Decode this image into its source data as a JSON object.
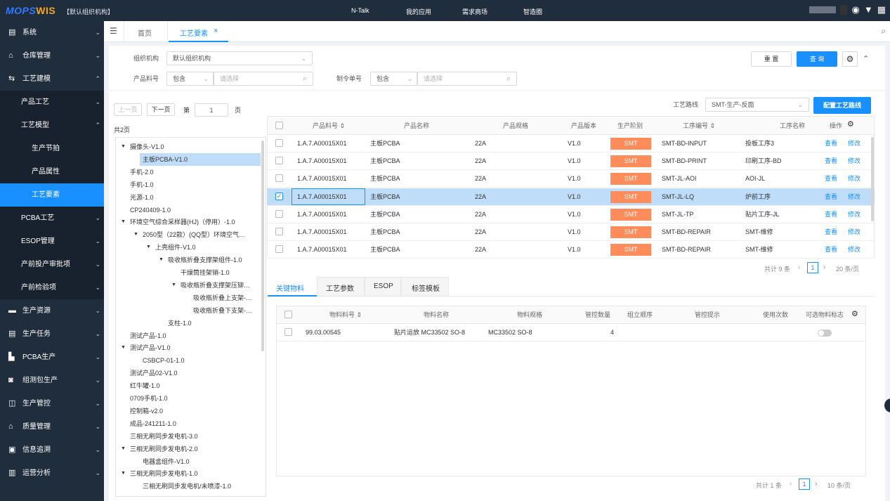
{
  "topbar": {
    "logo_a": "MOPS",
    "logo_b": "WIS",
    "org": "【默认组织机构】",
    "nav": [
      "N-Talk",
      "我的应用",
      "需求商场",
      "智造圈"
    ]
  },
  "sidebar": {
    "items": [
      {
        "icon": "▤",
        "label": "系统",
        "chev": "⌄"
      },
      {
        "icon": "⌂",
        "label": "仓库管理",
        "chev": "⌄"
      },
      {
        "icon": "⇆",
        "label": "工艺建模",
        "chev": "⌃"
      },
      {
        "label": "产品工艺",
        "chev": "⌄"
      },
      {
        "label": "工艺模型",
        "chev": "⌃"
      },
      {
        "label": "生产节拍"
      },
      {
        "label": "产品属性"
      },
      {
        "label": "工艺要素"
      },
      {
        "label": "PCBA工艺",
        "chev": "⌄"
      },
      {
        "label": "ESOP管理",
        "chev": "⌄"
      },
      {
        "label": "产前投产审批项",
        "chev": "⌄"
      },
      {
        "label": "产前检验项",
        "chev": "⌄"
      },
      {
        "icon": "▬",
        "label": "生产资源",
        "chev": "⌄"
      },
      {
        "icon": "▤",
        "label": "生产任务",
        "chev": "⌄"
      },
      {
        "icon": "▙",
        "label": "PCBA生产",
        "chev": "⌄"
      },
      {
        "icon": "◙",
        "label": "组测包生产",
        "chev": "⌄"
      },
      {
        "icon": "◫",
        "label": "生产管控",
        "chev": "⌄"
      },
      {
        "icon": "⌂",
        "label": "质量管理",
        "chev": "⌄"
      },
      {
        "icon": "▣",
        "label": "信息追溯",
        "chev": "⌄"
      },
      {
        "icon": "▥",
        "label": "运营分析",
        "chev": "⌄"
      }
    ]
  },
  "tabs": {
    "home": "首页",
    "active": "工艺要素",
    "close": "×"
  },
  "filters": {
    "org_label": "组织机构",
    "org_value": "默认组织机构",
    "pn_label": "产品料号",
    "pn_mode": "包含",
    "pn_placeholder": "请选择",
    "wo_label": "制令单号",
    "wo_mode": "包含",
    "wo_placeholder": "请选择",
    "reset": "重 置",
    "query": "查 询"
  },
  "pager": {
    "prev": "上一页",
    "next": "下一页",
    "di": "第",
    "page": "1",
    "ye": "页",
    "total": "共2页"
  },
  "tree": [
    {
      "t": "摄像头-V1.0",
      "d": 0,
      "o": "▼"
    },
    {
      "t": "主板PCBA-V1.0",
      "d": 1,
      "sel": true
    },
    {
      "t": "手机-2.0",
      "d": 0
    },
    {
      "t": "手机-1.0",
      "d": 0
    },
    {
      "t": "光源-1.0",
      "d": 0
    },
    {
      "t": "CP240409-1.0",
      "d": 0
    },
    {
      "t": "环境空气综合采样器(HJ)（停用）-1.0",
      "d": 0,
      "o": "▼"
    },
    {
      "t": "2050型（22款）(QQ型）环境空气…",
      "d": 1,
      "o": "▼"
    },
    {
      "t": "上壳组件-V1.0",
      "d": 2,
      "o": "▼"
    },
    {
      "t": "吸收瓶折叠支撑架组件-1.0",
      "d": 3,
      "o": "▼"
    },
    {
      "t": "干燥筒挂架销-1.0",
      "d": 4
    },
    {
      "t": "吸收瓶折叠支撑架压铆…",
      "d": 4,
      "o": "▼"
    },
    {
      "t": "吸收瓶折叠上支架-…",
      "d": 5
    },
    {
      "t": "吸收瓶折叠下支架-…",
      "d": 5
    },
    {
      "t": "支柱-1.0",
      "d": 3
    },
    {
      "t": "测试产品-1.0",
      "d": 0
    },
    {
      "t": "测试产品-V1.0",
      "d": 0,
      "o": "▼"
    },
    {
      "t": "CSBCP-01-1.0",
      "d": 1
    },
    {
      "t": "测试产品02-V1.0",
      "d": 0
    },
    {
      "t": "红牛罐-1.0",
      "d": 0
    },
    {
      "t": "0709手机-1.0",
      "d": 0
    },
    {
      "t": "控制箱-v2.0",
      "d": 0
    },
    {
      "t": "成品-241211-1.0",
      "d": 0
    },
    {
      "t": "三相无刷同步发电机-3.0",
      "d": 0
    },
    {
      "t": "三相无刷同步发电机-2.0",
      "d": 0,
      "o": "▼"
    },
    {
      "t": "电器盒组件-V1.0",
      "d": 1
    },
    {
      "t": "三相无刷同步发电机-1.0",
      "d": 0,
      "o": "▼"
    },
    {
      "t": "三相无刷同步发电机/未喷漆-1.0",
      "d": 1
    }
  ],
  "route": {
    "label": "工艺路线",
    "value": "SMT-生产-反面",
    "config": "配置工艺路线"
  },
  "grid": {
    "headers": [
      "产品料号 ⇕",
      "产品名称",
      "产品规格",
      "产品版本",
      "生产阶别",
      "工序编号 ⇕",
      "工序名称",
      "操作"
    ],
    "rows": [
      {
        "pn": "1.A.7.A00015X01",
        "name": "主板PCBA",
        "spec": "22A",
        "ver": "V1.0",
        "stage": "SMT",
        "code": "SMT-BD-INPUT",
        "proc": "投板工序3",
        "checked": false
      },
      {
        "pn": "1.A.7.A00015X01",
        "name": "主板PCBA",
        "spec": "22A",
        "ver": "V1.0",
        "stage": "SMT",
        "code": "SMT-BD-PRINT",
        "proc": "印刷工序-BD",
        "checked": false
      },
      {
        "pn": "1.A.7.A00015X01",
        "name": "主板PCBA",
        "spec": "22A",
        "ver": "V1.0",
        "stage": "SMT",
        "code": "SMT-JL-AOI",
        "proc": "AOI-JL",
        "checked": false
      },
      {
        "pn": "1.A.7.A00015X01",
        "name": "主板PCBA",
        "spec": "22A",
        "ver": "V1.0",
        "stage": "SMT",
        "code": "SMT-JL-LQ",
        "proc": "炉前工序",
        "checked": true
      },
      {
        "pn": "1.A.7.A00015X01",
        "name": "主板PCBA",
        "spec": "22A",
        "ver": "V1.0",
        "stage": "SMT",
        "code": "SMT-JL-TP",
        "proc": "贴片工序-JL",
        "checked": false
      },
      {
        "pn": "1.A.7.A00015X01",
        "name": "主板PCBA",
        "spec": "22A",
        "ver": "V1.0",
        "stage": "SMT",
        "code": "SMT-BD-REPAIR",
        "proc": "SMT-维修",
        "checked": false
      },
      {
        "pn": "1.A.7.A00015X01",
        "name": "主板PCBA",
        "spec": "22A",
        "ver": "V1.0",
        "stage": "SMT",
        "code": "SMT-BD-REPAIR",
        "proc": "SMT-维修",
        "checked": false
      }
    ],
    "view": "查看",
    "edit": "修改",
    "total": "共计 9 条",
    "page": "1",
    "size": "20 条/页"
  },
  "subtabs": [
    "关键物料",
    "工艺参数",
    "ESOP",
    "标签模板"
  ],
  "mat": {
    "headers": [
      "物料料号 ⇕",
      "物料名称",
      "物料规格",
      "管控数量",
      "组立顺序",
      "管控提示",
      "使用次数",
      "可选物料标志"
    ],
    "rows": [
      {
        "code": "99.03.00545",
        "name": "贴片运放 MC33502 SO-8",
        "spec": "MC33502 SO-8",
        "qty": "4"
      }
    ],
    "total": "共计 1 条",
    "page": "1",
    "size": "10 条/页"
  }
}
